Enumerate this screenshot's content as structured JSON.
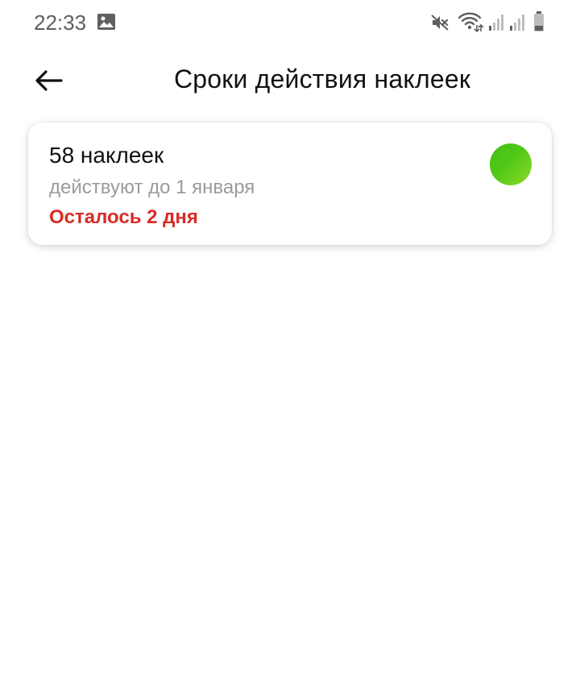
{
  "status_bar": {
    "time": "22:33",
    "icons": [
      "gallery-icon",
      "mute-icon",
      "wifi-icon",
      "signal-icon",
      "signal-icon",
      "battery-icon"
    ]
  },
  "header": {
    "back_icon": "arrow-left-icon",
    "title": "Сроки действия наклеек"
  },
  "stickers": {
    "count_label": "58 наклеек",
    "valid_until": "действуют до 1 января",
    "remaining": "Осталось 2 дня",
    "indicator_color": "#52c818",
    "remaining_color": "#d92b25"
  }
}
